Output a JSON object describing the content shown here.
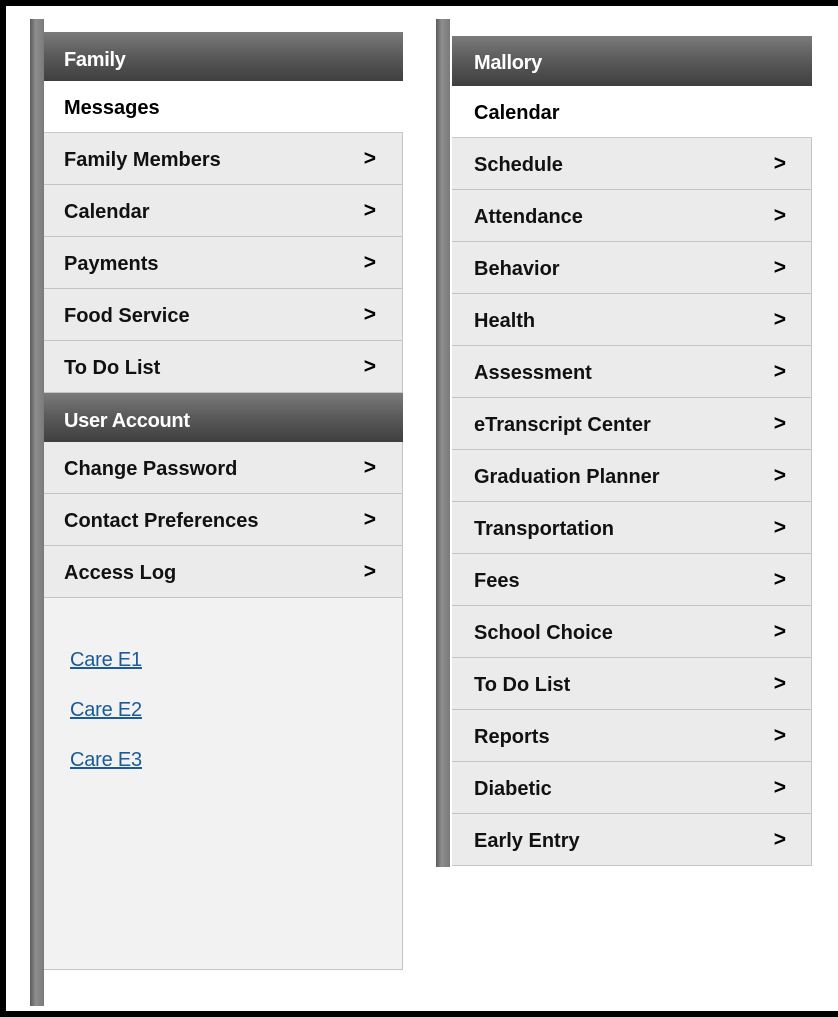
{
  "family_panel": {
    "header": "Family",
    "top_item": "Messages",
    "items": [
      {
        "label": "Family Members"
      },
      {
        "label": "Calendar"
      },
      {
        "label": "Payments"
      },
      {
        "label": "Food Service"
      },
      {
        "label": "To Do List"
      }
    ],
    "chevron": ">"
  },
  "user_account": {
    "header": "User Account",
    "items": [
      {
        "label": "Change Password"
      },
      {
        "label": "Contact Preferences"
      },
      {
        "label": "Access Log"
      }
    ]
  },
  "care_links": [
    {
      "label": "Care E1"
    },
    {
      "label": "Care E2"
    },
    {
      "label": "Care E3"
    }
  ],
  "student_panel": {
    "header": "Mallory",
    "top_item": "Calendar",
    "items": [
      {
        "label": "Schedule"
      },
      {
        "label": "Attendance"
      },
      {
        "label": "Behavior"
      },
      {
        "label": "Health"
      },
      {
        "label": "Assessment"
      },
      {
        "label": "eTranscript Center"
      },
      {
        "label": "Graduation Planner"
      },
      {
        "label": "Transportation"
      },
      {
        "label": "Fees"
      },
      {
        "label": "School Choice"
      },
      {
        "label": "To Do List"
      },
      {
        "label": "Reports"
      },
      {
        "label": "Diabetic"
      },
      {
        "label": "Early Entry"
      }
    ]
  },
  "colors": {
    "header_dark": "#3f3f3f",
    "item_bg": "#ebebeb",
    "link": "#1a5a9a"
  }
}
